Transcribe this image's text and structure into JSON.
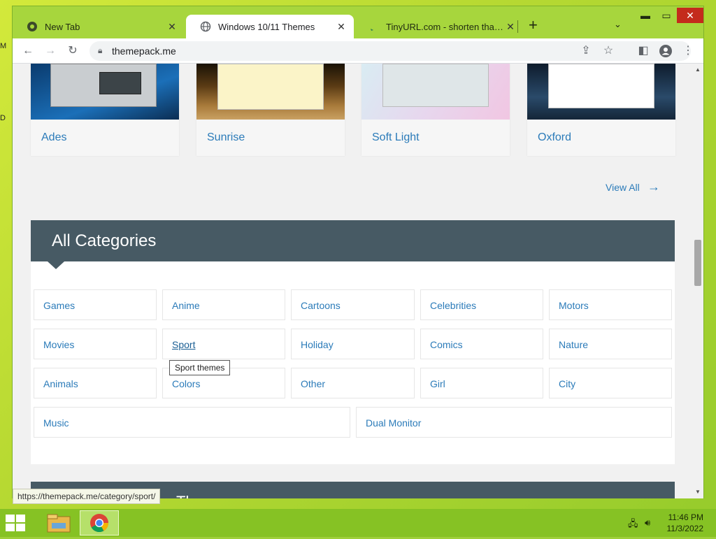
{
  "browser": {
    "tabs": [
      {
        "title": "New Tab",
        "active": false
      },
      {
        "title": "Windows 10/11 Themes",
        "active": true
      },
      {
        "title": "TinyURL.com - shorten that long",
        "active": false
      }
    ],
    "new_tab_label": "+",
    "url": "themepack.me"
  },
  "themes": [
    {
      "name": "Ades"
    },
    {
      "name": "Sunrise"
    },
    {
      "name": "Soft Light"
    },
    {
      "name": "Oxford"
    }
  ],
  "view_all": {
    "label": "View All"
  },
  "categories": {
    "title": "All Categories",
    "rows": [
      [
        "Games",
        "Anime",
        "Cartoons",
        "Celebrities",
        "Motors"
      ],
      [
        "Movies",
        "Sport",
        "Holiday",
        "Comics",
        "Nature"
      ],
      [
        "Animals",
        "Colors",
        "Other",
        "Girl",
        "City"
      ],
      [
        "Music",
        "Dual Monitor"
      ]
    ]
  },
  "next_section": {
    "title": "e Themes"
  },
  "tooltip": "Sport themes",
  "status_url": "https://themepack.me/category/sport/",
  "taskbar": {
    "time": "11:46 PM",
    "date": "11/3/2022"
  },
  "colors": {
    "link": "#2b7bb9",
    "header_bg": "#475a64",
    "frame": "#a7d63d"
  }
}
